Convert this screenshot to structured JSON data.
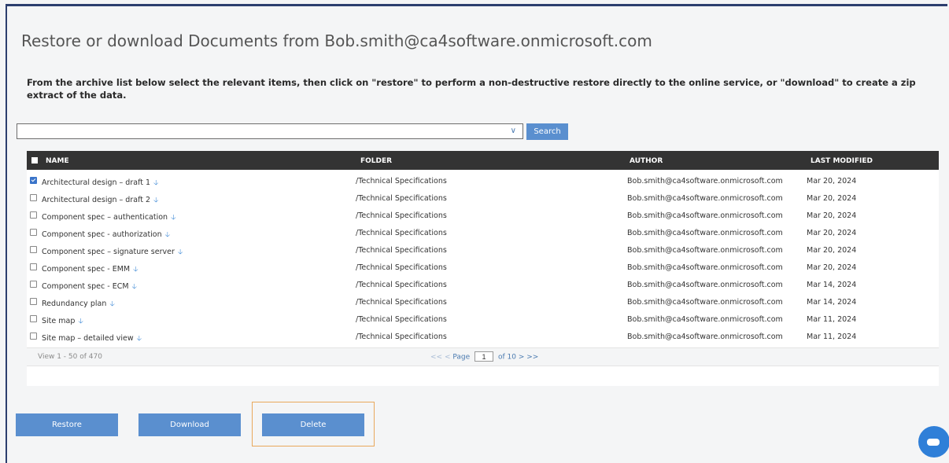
{
  "page": {
    "title": "Restore or download Documents from Bob.smith@ca4software.onmicrosoft.com",
    "intro": "From the archive list below select the relevant items, then click on \"restore\" to perform a non-destructive restore directly to the online service, or \"download\" to create a zip extract of the data."
  },
  "search": {
    "value": "",
    "button_label": "Search"
  },
  "table": {
    "headers": {
      "name": "NAME",
      "folder": "FOLDER",
      "author": "AUTHOR",
      "modified": "LAST MODIFIED"
    },
    "rows": [
      {
        "checked": true,
        "name": "Architectural design – draft 1",
        "folder": "/Technical Specifications",
        "author": "Bob.smith@ca4software.onmicrosoft.com",
        "modified": "Mar 20, 2024"
      },
      {
        "checked": false,
        "name": "Architectural design – draft 2",
        "folder": "/Technical Specifications",
        "author": "Bob.smith@ca4software.onmicrosoft.com",
        "modified": "Mar 20, 2024"
      },
      {
        "checked": false,
        "name": "Component spec – authentication",
        "folder": "/Technical Specifications",
        "author": "Bob.smith@ca4software.onmicrosoft.com",
        "modified": "Mar 20, 2024"
      },
      {
        "checked": false,
        "name": "Component spec - authorization",
        "folder": "/Technical Specifications",
        "author": "Bob.smith@ca4software.onmicrosoft.com",
        "modified": "Mar 20, 2024"
      },
      {
        "checked": false,
        "name": "Component spec – signature server",
        "folder": "/Technical Specifications",
        "author": "Bob.smith@ca4software.onmicrosoft.com",
        "modified": "Mar 20, 2024"
      },
      {
        "checked": false,
        "name": "Component spec - EMM",
        "folder": "/Technical Specifications",
        "author": "Bob.smith@ca4software.onmicrosoft.com",
        "modified": "Mar 20, 2024"
      },
      {
        "checked": false,
        "name": "Component spec - ECM",
        "folder": "/Technical Specifications",
        "author": "Bob.smith@ca4software.onmicrosoft.com",
        "modified": "Mar 14, 2024"
      },
      {
        "checked": false,
        "name": "Redundancy plan",
        "folder": "/Technical Specifications",
        "author": "Bob.smith@ca4software.onmicrosoft.com",
        "modified": "Mar 14, 2024"
      },
      {
        "checked": false,
        "name": "Site map",
        "folder": "/Technical Specifications",
        "author": "Bob.smith@ca4software.onmicrosoft.com",
        "modified": "Mar 11, 2024"
      },
      {
        "checked": false,
        "name": "Site map – detailed view",
        "folder": "/Technical Specifications",
        "author": "Bob.smith@ca4software.onmicrosoft.com",
        "modified": "Mar 11, 2024"
      }
    ]
  },
  "pagination": {
    "view_text": "View 1 - 50 of 470",
    "first": "<<",
    "prev": "<",
    "page_label": "Page",
    "current_page": "1",
    "of_text": "of 10",
    "next": ">",
    "last": ">>"
  },
  "actions": {
    "restore": "Restore",
    "download": "Download",
    "delete": "Delete"
  },
  "icons": {
    "download_row": "download-arrow-icon",
    "dropdown": "chevron-down-icon",
    "chat": "chat-icon"
  },
  "colors": {
    "accent": "#5a8fcf",
    "header_bg": "#333333",
    "highlight": "#e9a85b"
  }
}
